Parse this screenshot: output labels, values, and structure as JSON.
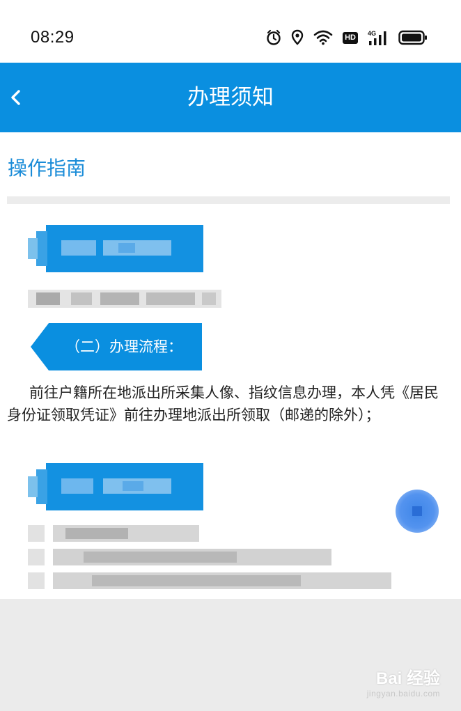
{
  "status_bar": {
    "time": "08:29",
    "icons": [
      "alarm-icon",
      "location-icon",
      "wifi-icon",
      "hd-icon",
      "signal-4g-icon",
      "battery-icon"
    ],
    "hd_label": "HD",
    "network_label": "4G"
  },
  "nav": {
    "title": "办理须知",
    "back_icon": "chevron-left-icon"
  },
  "content": {
    "section_title": "操作指南",
    "step2_label": "（二）办理流程：",
    "step2_body": "前往户籍所在地派出所采集人像、指纹信息办理，本人凭《居民身份证领取凭证》前往办理地派出所领取（邮递的除外）；"
  },
  "watermark": {
    "main": "Bai 经验",
    "sub": "jingyan.baidu.com"
  },
  "colors": {
    "accent": "#0a8fe0",
    "section_title": "#1a8cd8",
    "background": "#ebebeb"
  }
}
